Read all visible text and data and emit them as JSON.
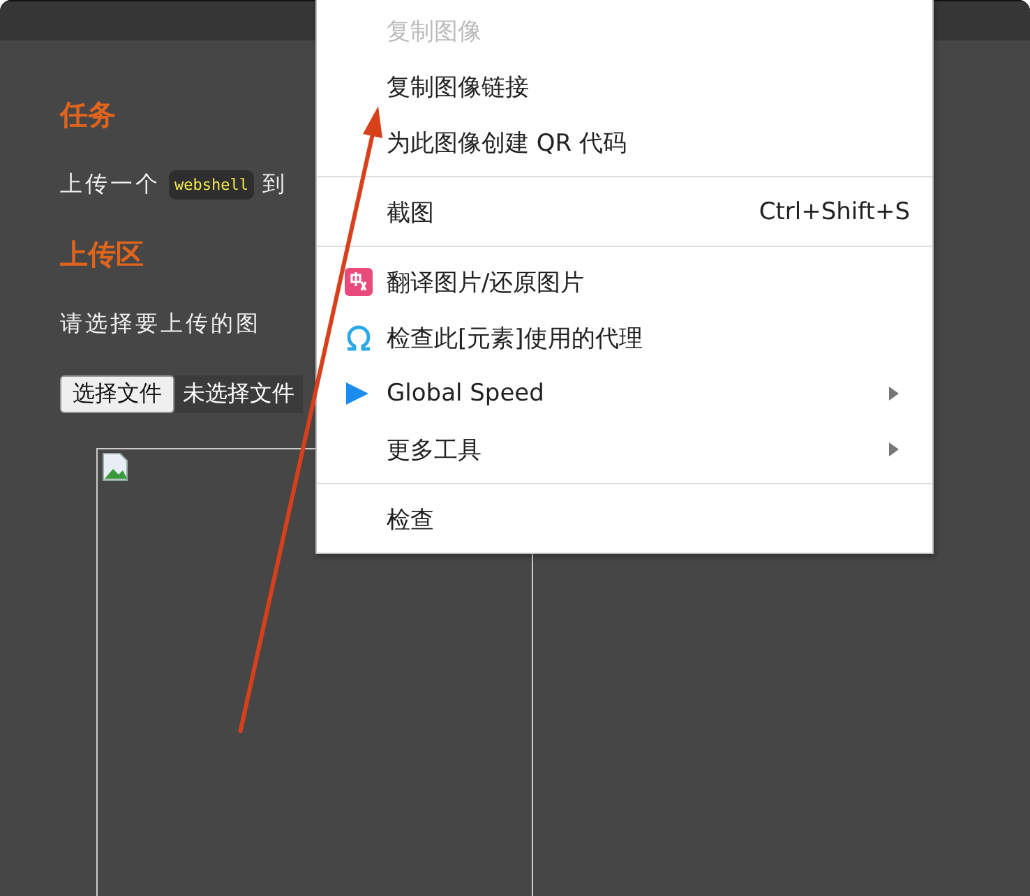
{
  "page": {
    "task_heading": "任务",
    "task_before": "上传一个",
    "task_code": "webshell",
    "task_after": "到",
    "upload_heading": "上传区",
    "upload_prompt": "请选择要上传的图",
    "file_button": "选择文件",
    "file_status": "未选择文件"
  },
  "context_menu": {
    "groups": [
      {
        "items": [
          {
            "label": "复制图像",
            "disabled": true
          },
          {
            "label": "复制图像链接",
            "disabled": false
          },
          {
            "label": "为此图像创建 QR 代码",
            "disabled": false
          }
        ]
      },
      {
        "items": [
          {
            "label": "截图",
            "disabled": false,
            "shortcut": "Ctrl+Shift+S"
          }
        ]
      },
      {
        "items": [
          {
            "label": "翻译图片/还原图片",
            "disabled": false,
            "kind": "translate"
          },
          {
            "label": "检查此[元素]使用的代理",
            "disabled": false,
            "kind": "omega"
          },
          {
            "label": "Global Speed",
            "disabled": false,
            "kind": "play",
            "submenu": true
          },
          {
            "label": "更多工具",
            "disabled": false,
            "submenu": true
          }
        ]
      },
      {
        "items": [
          {
            "label": "检查",
            "disabled": false
          }
        ]
      }
    ]
  }
}
